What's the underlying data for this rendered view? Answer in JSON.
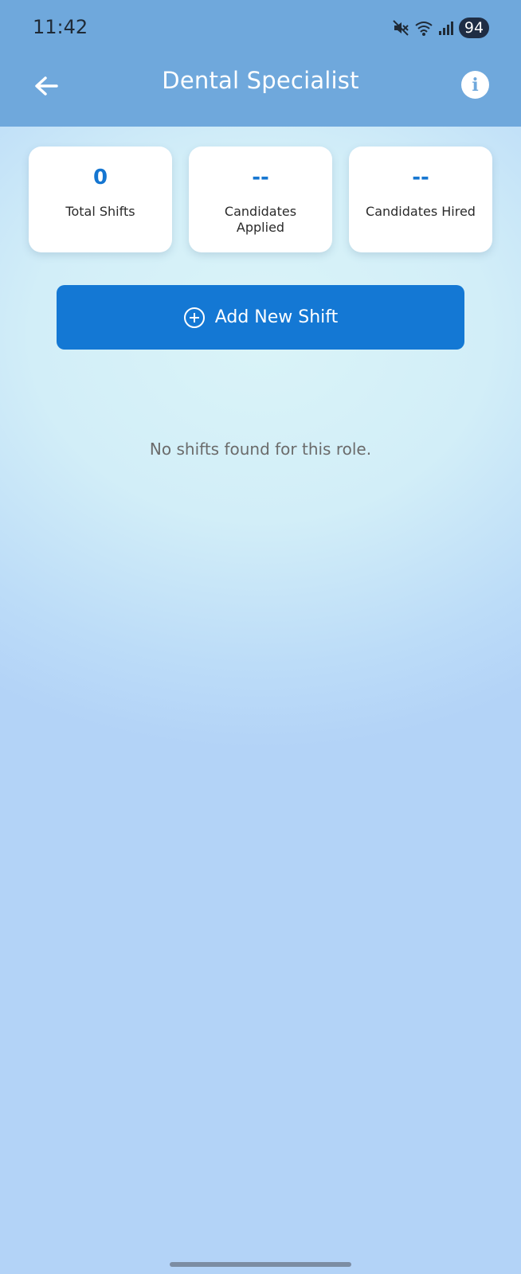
{
  "status_bar": {
    "time": "11:42",
    "battery": "94",
    "icons": [
      "mute-icon",
      "wifi-icon",
      "signal-icon"
    ]
  },
  "header": {
    "title": "Dental Specialist",
    "back_icon": "arrow-left-icon",
    "info_icon": "info-icon",
    "background": "#6fa8dc"
  },
  "stats": [
    {
      "value": "0",
      "label": "Total Shifts"
    },
    {
      "value": "--",
      "label": "Candidates Applied"
    },
    {
      "value": "--",
      "label": "Candidates Hired"
    }
  ],
  "add_button": {
    "label": "Add New Shift",
    "icon": "plus-circle-icon",
    "color": "#1478d4"
  },
  "empty_state": {
    "message": "No shifts found for this role."
  },
  "colors": {
    "accent": "#1576d1",
    "page_background": "#b3d3f7"
  }
}
